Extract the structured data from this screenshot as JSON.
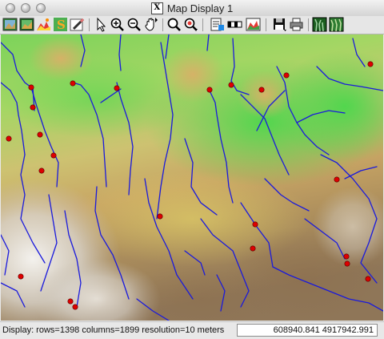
{
  "window": {
    "title": "Map Display 1"
  },
  "toolbar": {
    "tools": [
      {
        "name": "display-map-icon"
      },
      {
        "name": "redraw-icon"
      },
      {
        "name": "overlay-icon"
      },
      {
        "name": "query-icon"
      },
      {
        "name": "erase-icon"
      },
      {
        "name": "pointer-icon"
      },
      {
        "name": "zoom-in-icon"
      },
      {
        "name": "zoom-out-icon"
      },
      {
        "name": "pan-icon"
      },
      {
        "name": "zoom-back-icon"
      },
      {
        "name": "zoom-menu-icon"
      },
      {
        "name": "analyze-icon"
      },
      {
        "name": "scalebar-icon"
      },
      {
        "name": "decorations-icon"
      },
      {
        "name": "save-icon"
      },
      {
        "name": "print-icon"
      },
      {
        "name": "nviz-icon"
      },
      {
        "name": "profile-icon"
      }
    ]
  },
  "status": {
    "display_info": "Display: rows=1398 columns=1899  resolution=10 meters",
    "coordinates": "608940.841 4917942.991"
  },
  "colors": {
    "river": "#1a1adc",
    "site_point": "#dd0000"
  }
}
